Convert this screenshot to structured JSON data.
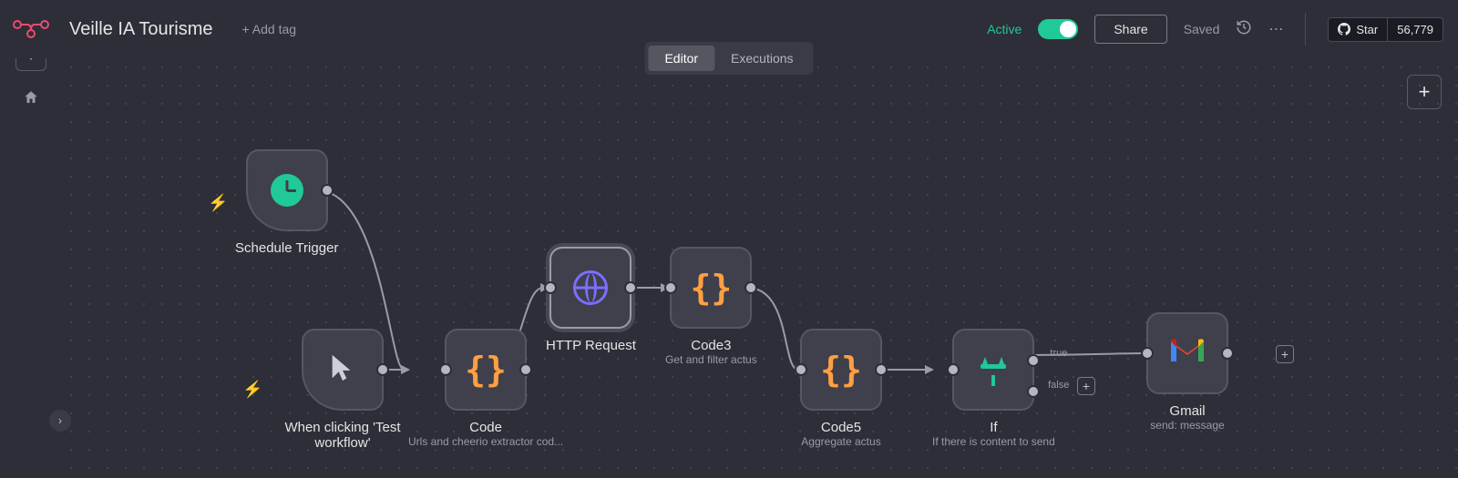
{
  "header": {
    "workflow_name": "Veille IA Tourisme",
    "add_tag": "+ Add tag",
    "active_label": "Active",
    "share": "Share",
    "saved": "Saved",
    "github_star": "Star",
    "github_count": "56,779"
  },
  "tabs": {
    "editor": "Editor",
    "executions": "Executions",
    "active": "editor"
  },
  "nodes": {
    "schedule_trigger": {
      "label": "Schedule Trigger"
    },
    "manual_trigger": {
      "label": "When clicking 'Test workflow'"
    },
    "code": {
      "label": "Code",
      "sublabel": "Urls and cheerio extractor cod..."
    },
    "http_request": {
      "label": "HTTP Request"
    },
    "code3": {
      "label": "Code3",
      "sublabel": "Get and filter actus"
    },
    "code5": {
      "label": "Code5",
      "sublabel": "Aggregate actus"
    },
    "if": {
      "label": "If",
      "sublabel": "If there is content to send",
      "true": "true",
      "false": "false"
    },
    "gmail": {
      "label": "Gmail",
      "sublabel": "send: message"
    }
  },
  "colors": {
    "accent": "#20c997",
    "code": "#ff9f43",
    "http": "#7b6fff",
    "trigger_bolt": "#ff6b6b"
  }
}
